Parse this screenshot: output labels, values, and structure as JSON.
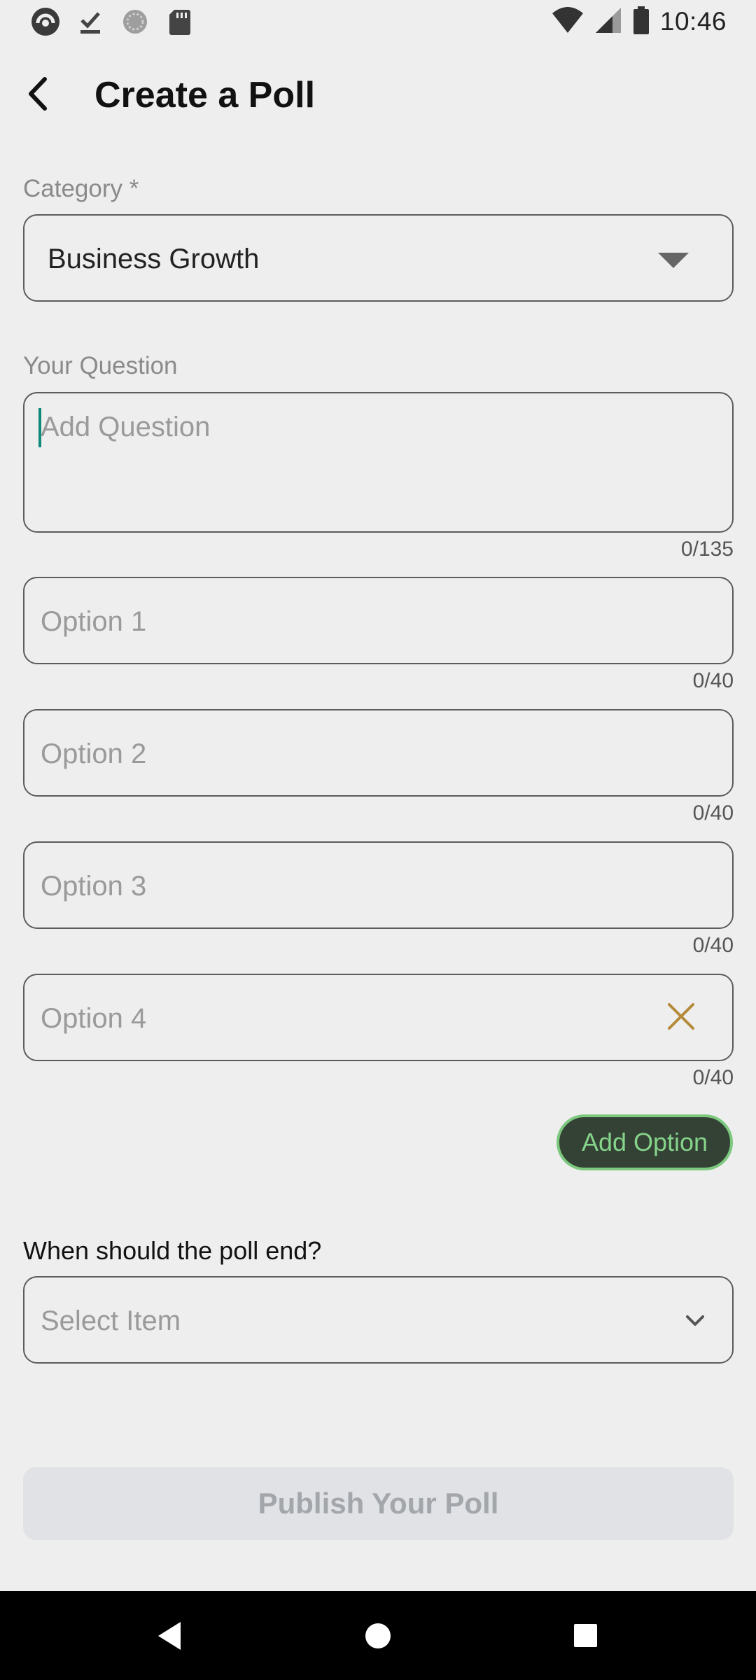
{
  "status_bar": {
    "time": "10:46",
    "left_icons": [
      "app-logo-icon",
      "download-done-icon",
      "sync-circle-icon",
      "sd-card-icon"
    ],
    "right_icons": [
      "wifi-icon",
      "cell-signal-icon",
      "battery-icon"
    ]
  },
  "app_bar": {
    "title": "Create a Poll",
    "back_icon": "chevron-left-icon"
  },
  "category": {
    "label": "Category *",
    "selected": "Business Growth"
  },
  "question": {
    "label": "Your Question",
    "placeholder": "Add Question",
    "value": "",
    "counter": "0/135"
  },
  "options": [
    {
      "placeholder": "Option 1",
      "counter": "0/40"
    },
    {
      "placeholder": "Option 2",
      "counter": "0/40"
    },
    {
      "placeholder": "Option 3",
      "counter": "0/40"
    },
    {
      "placeholder": "Option 4",
      "counter": "0/40",
      "removable": true
    }
  ],
  "add_option_label": "Add Option",
  "poll_end": {
    "question": "When should the poll end?",
    "placeholder": "Select Item"
  },
  "publish_label": "Publish Your Poll",
  "colors": {
    "background": "#eeeeee",
    "caret": "#0f8a7a",
    "add_option_bg": "#334235",
    "add_option_text": "#86d38a",
    "clear_icon": "#b58a3a",
    "publish_bg": "#e0e2e5",
    "publish_text": "#a3a6aa"
  },
  "nav_bar": {
    "icons": [
      "nav-back-icon",
      "nav-home-icon",
      "nav-recents-icon"
    ]
  }
}
